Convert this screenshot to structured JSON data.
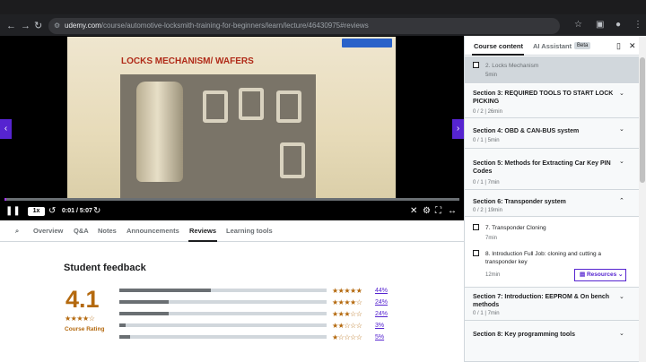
{
  "browser": {
    "url_domain": "udemy.com",
    "url_path": "/course/automotive-locksmith-training-for-beginners/learn/lecture/46430975#reviews"
  },
  "player": {
    "slide_title": "LOCKS MECHANISM/ WAFERS",
    "speed": "1x",
    "time": "0:01 / 5:07",
    "progress_fraction": 0.003
  },
  "tabs": [
    "Overview",
    "Q&A",
    "Notes",
    "Announcements",
    "Reviews",
    "Learning tools"
  ],
  "active_tab": "Reviews",
  "feedback": {
    "title": "Student feedback",
    "rating": "4.1",
    "rating_label": "Course Rating",
    "rows": [
      {
        "stars": 5,
        "pct": "44%",
        "fraction": 0.44
      },
      {
        "stars": 4,
        "pct": "24%",
        "fraction": 0.24
      },
      {
        "stars": 3,
        "pct": "24%",
        "fraction": 0.24
      },
      {
        "stars": 2,
        "pct": "3%",
        "fraction": 0.03
      },
      {
        "stars": 1,
        "pct": "5%",
        "fraction": 0.05
      }
    ]
  },
  "sidebar": {
    "tab_content": "Course content",
    "tab_ai": "AI Assistant",
    "beta": "Beta",
    "current_lecture": {
      "title": "2. Locks Mechanism",
      "meta": "5min"
    },
    "sections": [
      {
        "title": "Section 3: REQUIRED TOOLS TO START LOCK PICKING",
        "meta": "0 / 2 | 26min"
      },
      {
        "title": "Section 4: OBD & CAN-BUS system",
        "meta": "0 / 1 | 5min"
      },
      {
        "title": "Section 5: Methods for Extracting Car Key PIN Codes",
        "meta": "0 / 1 | 7min"
      },
      {
        "title": "Section 6: Transponder system",
        "meta": "0 / 2 | 19min"
      },
      {
        "title": "Section 7: Introduction: EEPROM & On bench methods",
        "meta": "0 / 1 | 7min"
      },
      {
        "title": "Section 8: Key programming tools",
        "meta": ""
      }
    ],
    "lectures": [
      {
        "title": "7. Transponder Cloning",
        "meta": "7min"
      },
      {
        "title": "8. Introduction Full Job: cloning and cutting a transponder key",
        "meta": "12min"
      }
    ],
    "resources_label": "Resources"
  },
  "colors": {
    "accent": "#5624d0",
    "star": "#b4690e",
    "progress": "#a435f0"
  }
}
